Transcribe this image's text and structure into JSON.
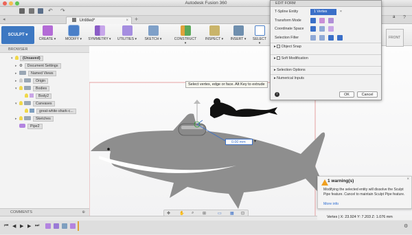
{
  "window": {
    "title": "Autodesk Fusion 360"
  },
  "tabs": [
    {
      "label": "Untitled*"
    }
  ],
  "toolbar": {
    "workspace": "SCULPT",
    "groups": [
      {
        "label": "CREATE ▾"
      },
      {
        "label": "MODIFY ▾"
      },
      {
        "label": "SYMMETRY ▾"
      },
      {
        "label": "UTILITIES ▾"
      },
      {
        "label": "SKETCH ▾"
      },
      {
        "label": "CONSTRUCT ▾"
      },
      {
        "label": "INSPECT ▾"
      },
      {
        "label": "INSERT ▾"
      },
      {
        "label": "SELECT ▾"
      }
    ],
    "user_initials": "a"
  },
  "browser": {
    "title": "BROWSER",
    "root": "(Unsaved)",
    "items": [
      {
        "label": "Document Settings"
      },
      {
        "label": "Named Views"
      },
      {
        "label": "Origin"
      },
      {
        "label": "Bodies"
      },
      {
        "label": "Body2"
      },
      {
        "label": "Canvases"
      },
      {
        "label": "great-white-shark-c..."
      },
      {
        "label": "Sketches"
      },
      {
        "label": "Pipe2"
      }
    ]
  },
  "comments": {
    "label": "COMMENTS"
  },
  "edit_form": {
    "title": "EDIT FORM",
    "tspline_entity_label": "T-Spline Entity",
    "tspline_entity_value": "1 Vertex",
    "transform_mode_label": "Transform Mode",
    "coordinate_space_label": "Coordinate Space",
    "selection_filter_label": "Selection Filter",
    "object_snap": "Object Snap",
    "soft_modification": "Soft Modification",
    "selection_options": "Selection Options",
    "numerical_inputs": "Numerical Inputs",
    "ok": "OK",
    "cancel": "Cancel"
  },
  "canvas": {
    "tooltip": "Select vertex, edge or face. Alt Key to extrude",
    "value_input": "0.00 mm",
    "viewcube_label": "FRONT"
  },
  "warning": {
    "title": "1 warning(s)",
    "message": "Modifying the selected entity will dissolve the Sculpt Pipe feature.  Cancel to maintain Sculpt Pipe feature.",
    "link": "More info"
  },
  "status": {
    "coordinates": "Vertex | X: 23.924 Y: 7.203 Z: 1.076 mm"
  },
  "colors": {
    "accent": "#3d78c2",
    "warning": "#f0a020",
    "selection_border": "#e08a8a"
  }
}
